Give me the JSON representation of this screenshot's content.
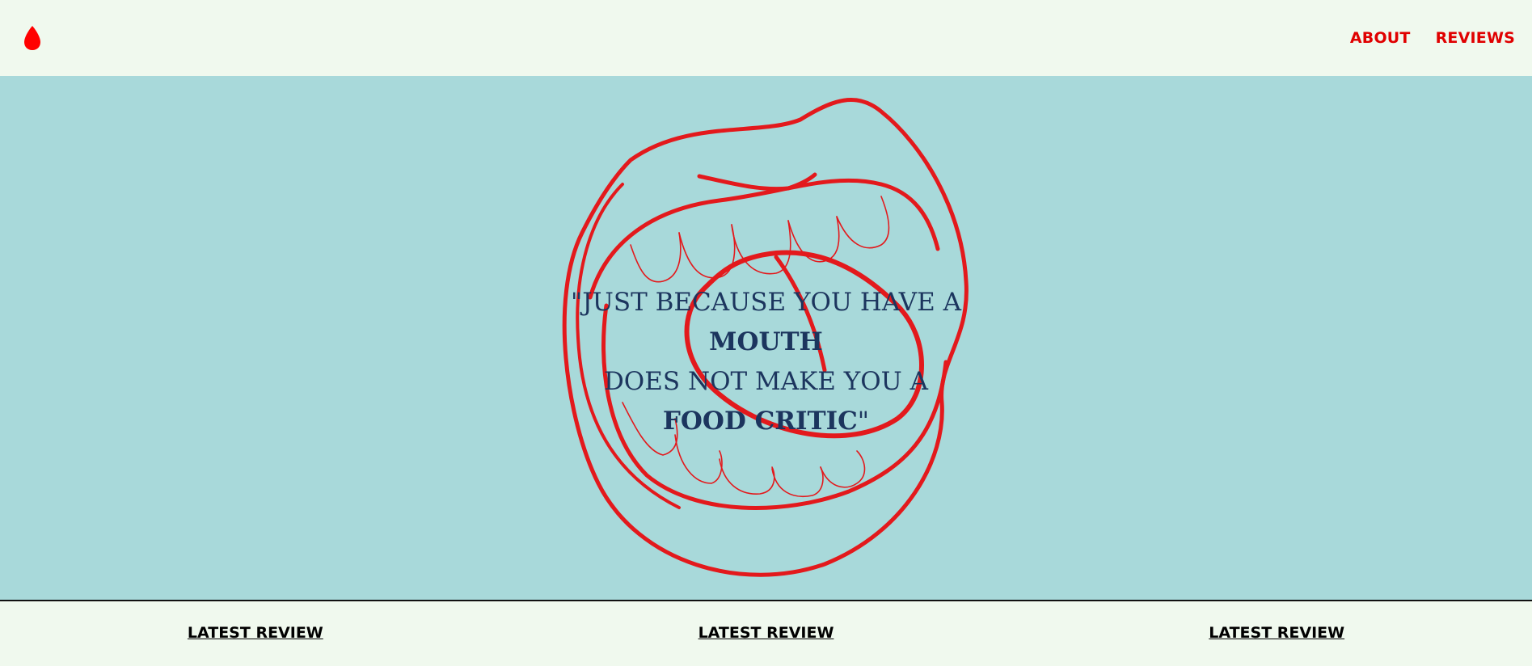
{
  "header": {
    "logo_icon": "red-drop-icon",
    "nav": [
      {
        "label": "ABOUT"
      },
      {
        "label": "REVIEWS"
      }
    ]
  },
  "hero": {
    "quote_line1": "\"JUST BECAUSE YOU HAVE A",
    "quote_bold1": "MOUTH",
    "quote_line3": "DOES NOT MAKE YOU A",
    "quote_bold2": "FOOD CRITIC",
    "quote_end": "\"",
    "image": "embroidered-mouth-illustration"
  },
  "footer": {
    "columns": [
      {
        "label": "LATEST REVIEW"
      },
      {
        "label": "LATEST REVIEW"
      },
      {
        "label": "LATEST REVIEW"
      }
    ]
  },
  "colors": {
    "accent": "#e00000",
    "hero_bg": "#a8d9da",
    "page_bg": "#f0f9ee",
    "quote": "#1c355e"
  }
}
